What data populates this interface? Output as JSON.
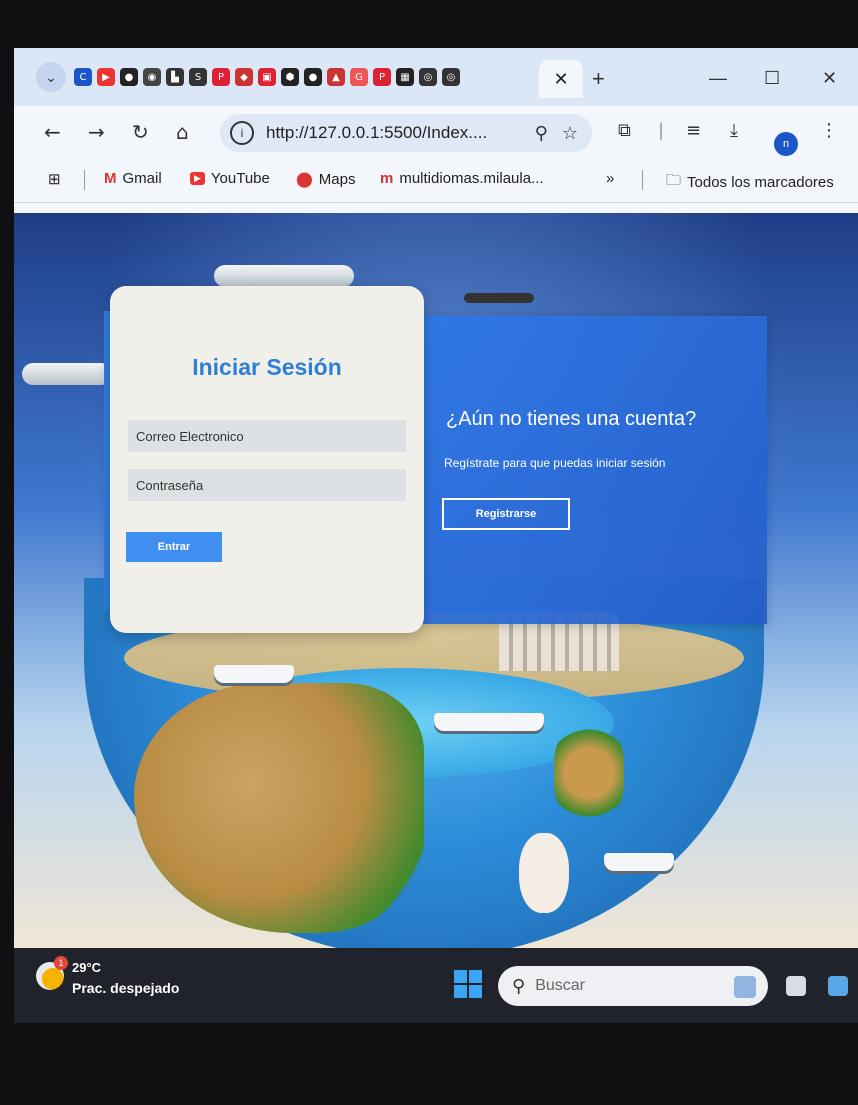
{
  "browser": {
    "tab_close": "✕",
    "new_tab": "+",
    "window_controls": {
      "minimize": "—",
      "maximize": "☐",
      "close": "✕"
    },
    "url": "http://127.0.0.1:5500/Index....",
    "nav": {
      "back": "←",
      "forward": "→",
      "reload": "↻",
      "home": "⌂"
    },
    "profile_initial": "n",
    "bookmarks": [
      {
        "label": "Gmail",
        "icon": "gmail-icon"
      },
      {
        "label": "YouTube",
        "icon": "youtube-icon"
      },
      {
        "label": "Maps",
        "icon": "maps-icon"
      },
      {
        "label": "multidiomas.milaula...",
        "icon": "site-icon"
      }
    ],
    "bookmarks_overflow": "»",
    "all_bookmarks": "Todos los marcadores"
  },
  "login": {
    "title": "Iniciar Sesión",
    "email_placeholder": "Correo Electronico",
    "password_placeholder": "Contraseña",
    "submit_label": "Entrar"
  },
  "register": {
    "title": "¿Aún no tienes una cuenta?",
    "text": "Regístrate para que puedas iniciar sesión",
    "button_label": "Registrarse"
  },
  "taskbar": {
    "weather_badge": "1",
    "temperature": "29°C",
    "condition": "Prac. despejado",
    "search_placeholder": "Buscar"
  },
  "colors": {
    "accent_blue": "#2f7fd6",
    "button_blue": "#3f8ff0",
    "panel_blue": "#2f78e6",
    "card_bg": "#f0efe9"
  }
}
